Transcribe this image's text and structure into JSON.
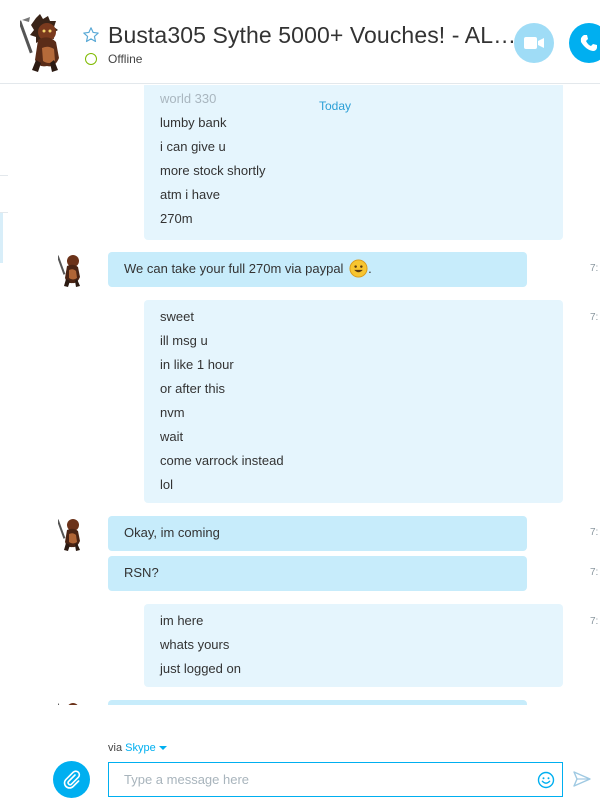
{
  "header": {
    "contact_name": "Busta305 Sythe 5000+ Vouches! - AL…",
    "status": "Offline"
  },
  "chat": {
    "date_divider": "Today",
    "messages": [
      {
        "from": "them",
        "lines": [
          "world 330",
          "lumby bank",
          "i can give u",
          "more stock shortly",
          "atm i have",
          "270m"
        ]
      },
      {
        "from": "me",
        "text": "We can take your full 270m via paypal",
        "emoji": "smiley",
        "suffix": ".",
        "time": "7:"
      },
      {
        "from": "them",
        "lines": [
          "sweet",
          "ill msg u",
          "in like 1 hour",
          "or after this",
          "nvm",
          "wait",
          "come varrock instead",
          "lol"
        ],
        "time": "7:"
      },
      {
        "from": "me",
        "text": "Okay, im coming",
        "time": "7:"
      },
      {
        "from": "me",
        "text": "RSN?",
        "time": "7:"
      },
      {
        "from": "them",
        "lines": [
          "im here",
          "whats yours",
          "just logged on"
        ],
        "time": "7:"
      }
    ]
  },
  "composer": {
    "via_label": "via",
    "via_service": "Skype",
    "placeholder": "Type a message here"
  },
  "colors": {
    "accent": "#00aff0",
    "incoming_bubble": "#e5f5fd",
    "outgoing_bubble": "#c7ecfb",
    "online_ring": "#7fba00"
  },
  "icons": [
    "star-icon",
    "video-camera-icon",
    "phone-icon",
    "paperclip-icon",
    "emoji-icon",
    "send-icon"
  ]
}
